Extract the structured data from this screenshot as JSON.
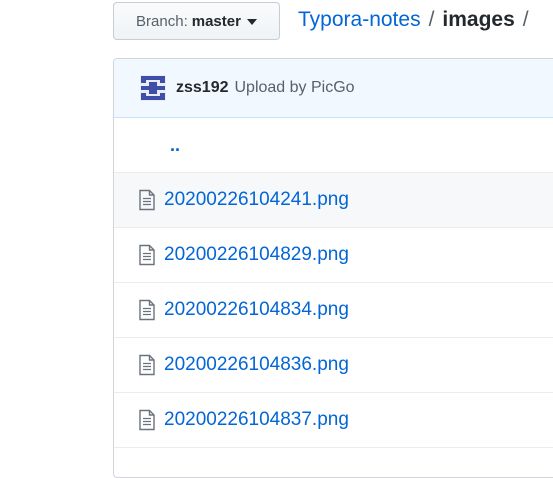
{
  "branch": {
    "label": "Branch:",
    "value": "master"
  },
  "breadcrumb": {
    "repo": "Typora-notes",
    "separator": "/",
    "current": "images",
    "trailing_separator": "/"
  },
  "commit": {
    "author": "zss192",
    "message": "Upload by PicGo"
  },
  "parent_link": "..",
  "files": [
    {
      "name": "20200226104241.png",
      "icon": "file-icon"
    },
    {
      "name": "20200226104829.png",
      "icon": "file-icon"
    },
    {
      "name": "20200226104834.png",
      "icon": "file-icon"
    },
    {
      "name": "20200226104836.png",
      "icon": "file-icon"
    },
    {
      "name": "20200226104837.png",
      "icon": "file-icon"
    }
  ],
  "colors": {
    "link": "#0366d6",
    "commit_bar_bg": "#f1f8ff",
    "avatar": "#3f4fa8",
    "hover_row_bg": "#f6f8fa"
  }
}
